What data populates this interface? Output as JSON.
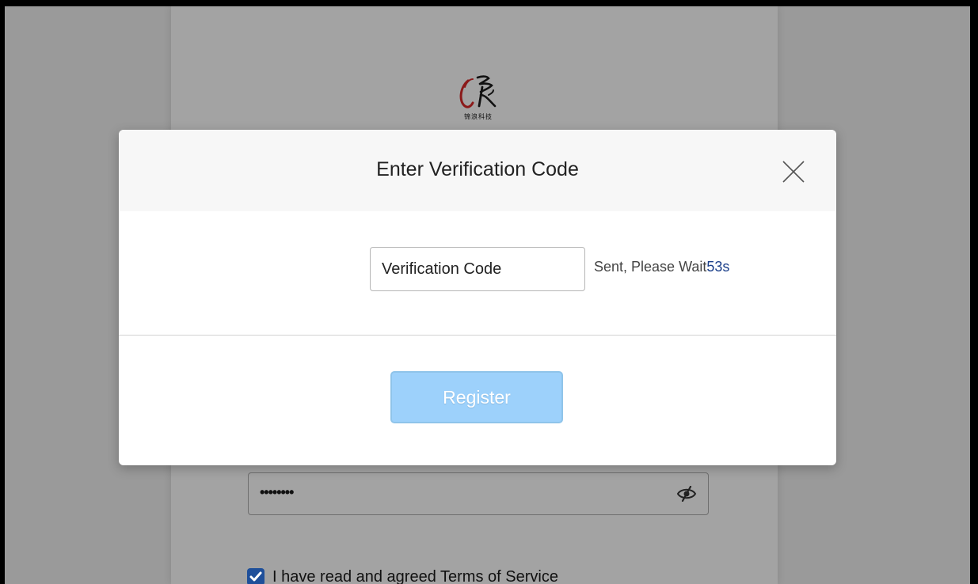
{
  "background_page": {
    "logo": {
      "icon": "brand-logo-icon",
      "caption": "锦浪科技",
      "accent_color": "#8b1a1a"
    },
    "password_field": {
      "value": "••••••••",
      "toggle_icon": "eye-slash-icon"
    },
    "terms": {
      "checked": true,
      "label": "I have read and agreed Terms of Service"
    }
  },
  "modal": {
    "title": "Enter Verification Code",
    "close_icon": "close-icon",
    "code_input": {
      "placeholder": "Verification Code",
      "value": ""
    },
    "countdown": {
      "prefix": "Sent, Please Wait",
      "seconds": "53s"
    },
    "register_label": "Register",
    "colors": {
      "register_bg": "#9dd1fb",
      "countdown_accent": "#1b3f8a"
    }
  }
}
